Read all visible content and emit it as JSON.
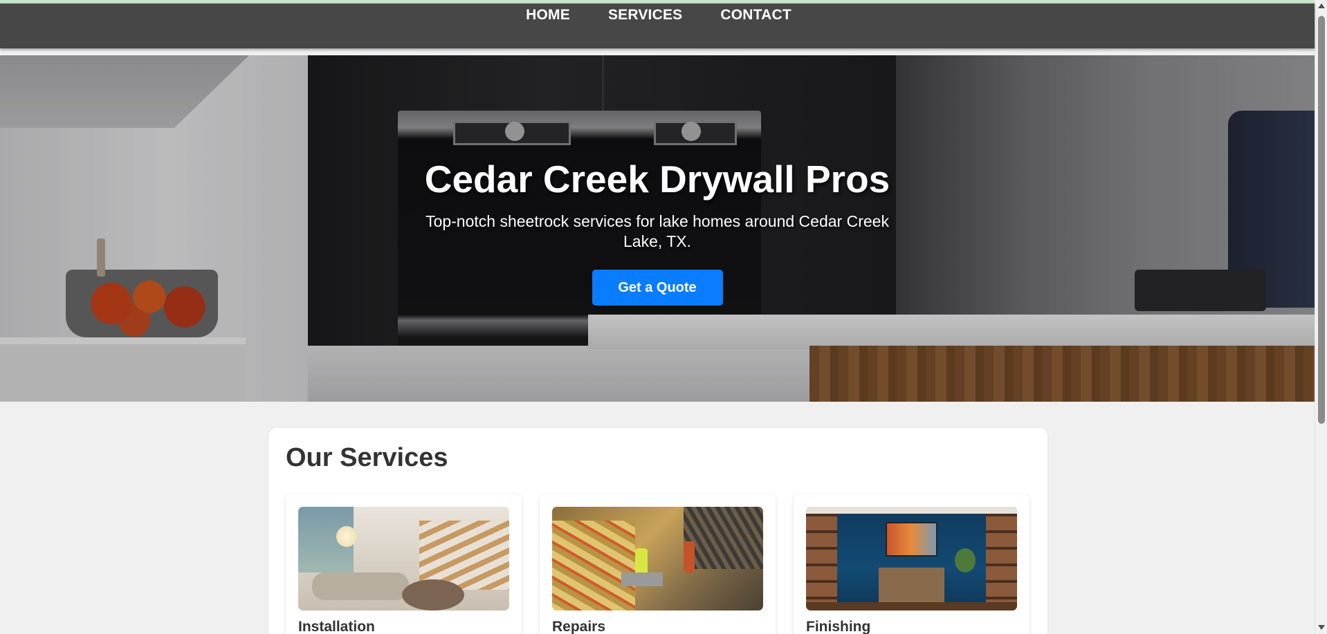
{
  "nav": {
    "items": [
      {
        "label": "HOME"
      },
      {
        "label": "SERVICES"
      },
      {
        "label": "CONTACT"
      }
    ]
  },
  "hero": {
    "title": "Cedar Creek Drywall Pros",
    "subtitle": "Top-notch sheetrock services for lake homes around Cedar Creek Lake, TX.",
    "cta_label": "Get a Quote"
  },
  "services": {
    "heading": "Our Services",
    "cards": [
      {
        "title": "Installation"
      },
      {
        "title": "Repairs"
      },
      {
        "title": "Finishing"
      }
    ]
  },
  "colors": {
    "navbar": "#474747",
    "accent": "#0a7cff",
    "page_background": "#f0f0f0"
  }
}
